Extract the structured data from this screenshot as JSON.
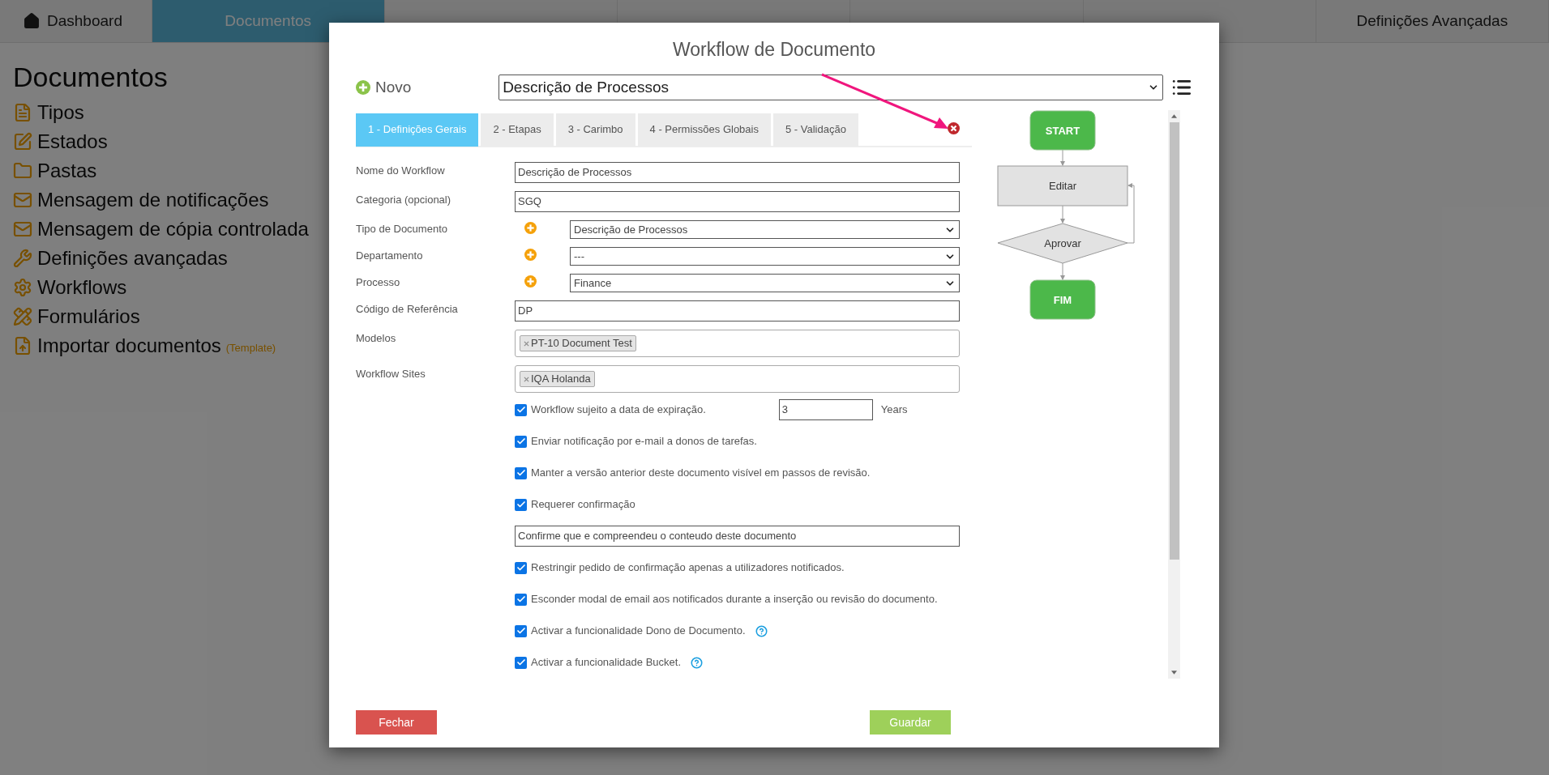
{
  "nav": {
    "items": [
      {
        "label": "Dashboard",
        "selected": false
      },
      {
        "label": "Documentos",
        "selected": true
      },
      {
        "selected": false
      },
      {
        "selected": false
      },
      {
        "selected": false
      },
      {
        "selected": false
      },
      {
        "label": "Definições Avançadas",
        "selected": false
      }
    ]
  },
  "sidebar": {
    "title": "Documentos",
    "items": [
      {
        "label": "Tipos"
      },
      {
        "label": "Estados"
      },
      {
        "label": "Pastas"
      },
      {
        "label": "Mensagem de notificações"
      },
      {
        "label": "Mensagem de cópia controlada"
      },
      {
        "label": "Definições avançadas"
      },
      {
        "label": "Workflows"
      },
      {
        "label": "Formulários"
      },
      {
        "label": "Importar documentos",
        "note": "(Template)"
      }
    ]
  },
  "modal": {
    "title": "Workflow de Documento",
    "new_button": "Novo",
    "workflow_select": "Descrição de Processos",
    "tabs": [
      {
        "label": "1 - Definições Gerais",
        "selected": true
      },
      {
        "label": "2 - Etapas",
        "selected": false
      },
      {
        "label": "3 - Carimbo",
        "selected": false
      },
      {
        "label": "4 - Permissões Globais",
        "selected": false
      },
      {
        "label": "5 - Validação",
        "selected": false
      }
    ],
    "fields": [
      {
        "kind": "text",
        "label": "Nome do Workflow",
        "value": "Descrição de Processos"
      },
      {
        "kind": "text",
        "label": "Categoria (opcional)",
        "value": "SGQ"
      },
      {
        "kind": "select",
        "label": "Tipo de Documento",
        "value": "Descrição de Processos"
      },
      {
        "kind": "select",
        "label": "Departamento",
        "value": "---"
      },
      {
        "kind": "select",
        "label": "Processo",
        "value": "Finance"
      },
      {
        "kind": "text",
        "label": "Código de Referência",
        "value": "DP"
      },
      {
        "kind": "tags",
        "label": "Modelos",
        "tags": [
          "PT-10 Document Test"
        ]
      },
      {
        "kind": "tags",
        "label": "Workflow Sites",
        "tags": [
          "IQA Holanda"
        ]
      }
    ],
    "options": [
      {
        "kind": "checkbox",
        "label": "Workflow sujeito a data de expiração.",
        "checked": true,
        "value": "3",
        "unit": "Years"
      },
      {
        "kind": "checkbox",
        "label": "Enviar notificação por e-mail a donos de tarefas.",
        "checked": true
      },
      {
        "kind": "checkbox",
        "label": "Manter a versão anterior deste documento visível em passos de revisão.",
        "checked": true
      },
      {
        "kind": "checkbox",
        "label": "Requerer confirmação",
        "checked": true
      },
      {
        "kind": "text",
        "value": "Confirme que e compreendeu o conteudo deste documento"
      },
      {
        "kind": "checkbox",
        "label": "Restringir pedido de confirmação apenas a utilizadores notificados.",
        "checked": true
      },
      {
        "kind": "checkbox",
        "label": "Esconder modal de email aos notificados durante a inserção ou revisão do documento.",
        "checked": true
      },
      {
        "kind": "checkbox",
        "label": "Activar a funcionalidade Dono de Documento.",
        "checked": true,
        "help": true
      },
      {
        "kind": "checkbox",
        "label": "Activar a funcionalidade Bucket.",
        "checked": true,
        "help": true
      }
    ],
    "flow": [
      {
        "kind": "terminal",
        "label": "START"
      },
      {
        "kind": "process",
        "label": "Editar"
      },
      {
        "kind": "decision",
        "label": "Aprovar"
      },
      {
        "kind": "terminal",
        "label": "FIM"
      }
    ],
    "close_button": "Fechar",
    "save_button": "Guardar"
  }
}
